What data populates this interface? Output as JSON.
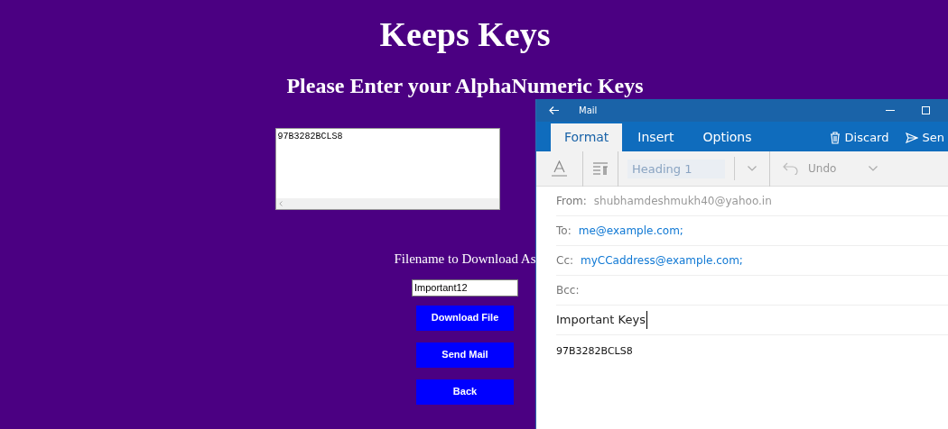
{
  "page": {
    "title": "Keeps Keys",
    "subtitle": "Please Enter your AlphaNumeric Keys",
    "keys_textarea": {
      "value": "97B3282BCLS8"
    },
    "filename_label": "Filename to Download As",
    "filename_field": {
      "value": "Important12"
    },
    "buttons": [
      "Download File",
      "Send Mail",
      "Back"
    ]
  },
  "mail_window": {
    "title": "Mail",
    "tabs": [
      {
        "label": "Format",
        "selected": true
      },
      {
        "label": "Insert",
        "selected": false
      },
      {
        "label": "Options",
        "selected": false
      }
    ],
    "actions": [
      {
        "label": "Discard",
        "kind": "discard"
      },
      {
        "label": "Sen",
        "kind": "send"
      }
    ],
    "toolbar": {
      "style_dropdown": "Heading 1",
      "undo": "Undo"
    },
    "fields": [
      {
        "label": "From:",
        "value": "shubhamdeshmukh40@yahoo.in",
        "kind": "sender"
      },
      {
        "label": "To:",
        "value": "me@example.com;",
        "kind": "recipient"
      },
      {
        "label": "Cc:",
        "value": "myCCaddress@example.com;",
        "kind": "recipient"
      },
      {
        "label": "Bcc:"
      }
    ],
    "subject": {
      "value": "Important Keys",
      "focused": true
    },
    "body": "97B3282BCLS8"
  }
}
